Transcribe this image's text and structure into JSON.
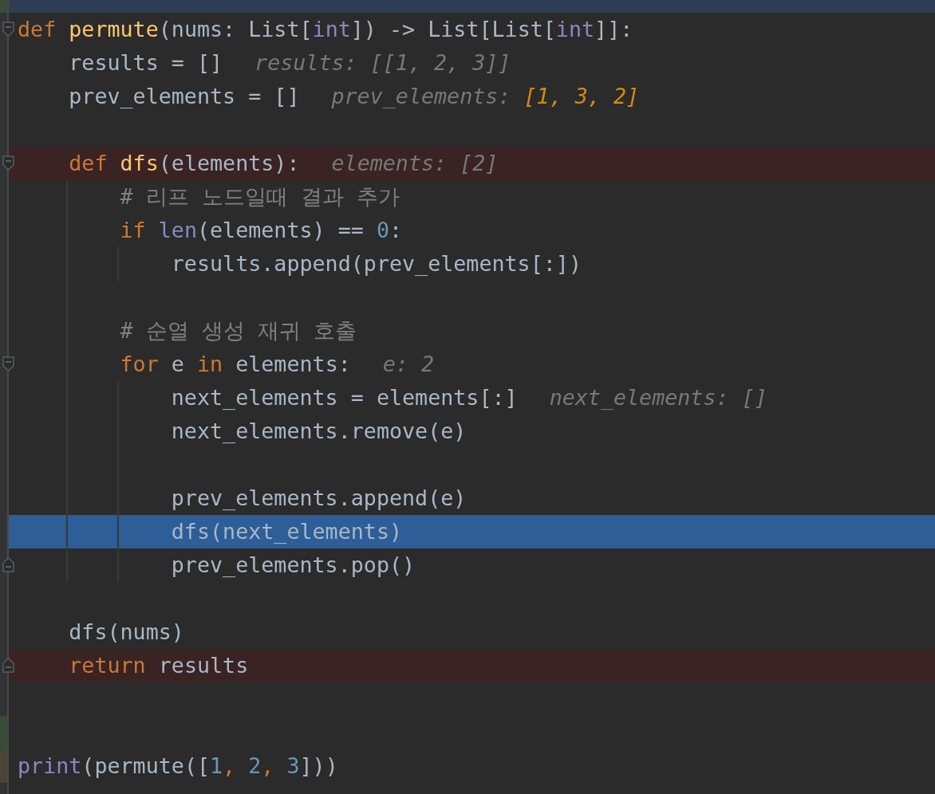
{
  "editor": {
    "partial_top_line": {
      "selected": true,
      "color": "#384c38"
    },
    "lines": [
      {
        "fold_start": true,
        "fold_end": false,
        "breakpoint": false,
        "current": false,
        "tokens": [
          {
            "text": "def ",
            "kind": "keyword"
          },
          {
            "text": "permute",
            "kind": "function"
          },
          {
            "text": "(nums: List[",
            "kind": "plain"
          },
          {
            "text": "int",
            "kind": "builtin"
          },
          {
            "text": "]) -> List[List[",
            "kind": "plain"
          },
          {
            "text": "int",
            "kind": "builtin"
          },
          {
            "text": "]]:",
            "kind": "plain"
          }
        ]
      },
      {
        "fold_start": false,
        "fold_end": false,
        "breakpoint": false,
        "current": false,
        "tokens": [
          {
            "text": "    results = []",
            "kind": "plain"
          }
        ],
        "inline_value": {
          "name": "results: ",
          "value": "[[1, 2, 3]]",
          "changed": false
        }
      },
      {
        "fold_start": false,
        "fold_end": false,
        "breakpoint": false,
        "current": false,
        "tokens": [
          {
            "text": "    prev_elements = []",
            "kind": "plain"
          }
        ],
        "inline_value": {
          "name": "prev_elements: ",
          "value": "[1, 3, 2]",
          "changed": true
        }
      },
      {
        "fold_start": false,
        "fold_end": false,
        "breakpoint": false,
        "current": false
      },
      {
        "fold_start": true,
        "fold_end": false,
        "breakpoint": true,
        "current": false,
        "tokens": [
          {
            "text": "    def ",
            "kind": "keyword"
          },
          {
            "text": "dfs",
            "kind": "function"
          },
          {
            "text": "(elements):",
            "kind": "plain"
          }
        ],
        "inline_value": {
          "name": "elements: ",
          "value": "[2]",
          "changed": false
        }
      },
      {
        "fold_start": false,
        "fold_end": false,
        "breakpoint": false,
        "current": false,
        "tokens": [
          {
            "text": "        # 리프 노드일때 결과 추가",
            "kind": "comment"
          }
        ]
      },
      {
        "fold_start": false,
        "fold_end": false,
        "breakpoint": false,
        "current": false,
        "tokens": [
          {
            "text": "        if ",
            "kind": "keyword"
          },
          {
            "text": "len",
            "kind": "builtin"
          },
          {
            "text": "(elements) == ",
            "kind": "plain"
          },
          {
            "text": "0",
            "kind": "number"
          },
          {
            "text": ":",
            "kind": "plain"
          }
        ]
      },
      {
        "fold_start": false,
        "fold_end": false,
        "breakpoint": false,
        "current": false,
        "tokens": [
          {
            "text": "            results.append(prev_elements[:])",
            "kind": "plain"
          }
        ]
      },
      {
        "fold_start": false,
        "fold_end": false,
        "breakpoint": false,
        "current": false
      },
      {
        "fold_start": false,
        "fold_end": false,
        "breakpoint": false,
        "current": false,
        "tokens": [
          {
            "text": "        # 순열 생성 재귀 호출",
            "kind": "comment"
          }
        ]
      },
      {
        "fold_start": true,
        "fold_end": false,
        "breakpoint": false,
        "current": false,
        "tokens": [
          {
            "text": "        for ",
            "kind": "keyword"
          },
          {
            "text": "e ",
            "kind": "plain"
          },
          {
            "text": "in ",
            "kind": "keyword"
          },
          {
            "text": "elements:",
            "kind": "plain"
          }
        ],
        "inline_value": {
          "name": "e: ",
          "value": "2",
          "changed": false
        }
      },
      {
        "fold_start": false,
        "fold_end": false,
        "breakpoint": false,
        "current": false,
        "tokens": [
          {
            "text": "            next_elements = elements[:]",
            "kind": "plain"
          }
        ],
        "inline_value": {
          "name": "next_elements: ",
          "value": "[]",
          "changed": false
        }
      },
      {
        "fold_start": false,
        "fold_end": false,
        "breakpoint": false,
        "current": false,
        "tokens": [
          {
            "text": "            next_elements.remove(e)",
            "kind": "plain"
          }
        ]
      },
      {
        "fold_start": false,
        "fold_end": false,
        "breakpoint": false,
        "current": false
      },
      {
        "fold_start": false,
        "fold_end": false,
        "breakpoint": false,
        "current": false,
        "tokens": [
          {
            "text": "            prev_elements.append(e)",
            "kind": "plain"
          }
        ]
      },
      {
        "fold_start": false,
        "fold_end": false,
        "breakpoint": false,
        "current": true,
        "tokens": [
          {
            "text": "            dfs(next_elements)",
            "kind": "plain"
          }
        ]
      },
      {
        "fold_start": false,
        "fold_end": true,
        "breakpoint": false,
        "current": false,
        "tokens": [
          {
            "text": "            prev_elements.pop()",
            "kind": "plain"
          }
        ]
      },
      {
        "fold_start": false,
        "fold_end": false,
        "breakpoint": false,
        "current": false
      },
      {
        "fold_start": false,
        "fold_end": false,
        "breakpoint": false,
        "current": false,
        "tokens": [
          {
            "text": "    dfs(nums)",
            "kind": "plain"
          }
        ]
      },
      {
        "fold_start": false,
        "fold_end": true,
        "breakpoint": true,
        "current": false,
        "tokens": [
          {
            "text": "    return ",
            "kind": "keyword"
          },
          {
            "text": "results",
            "kind": "plain"
          }
        ]
      },
      {
        "fold_start": false,
        "fold_end": false,
        "breakpoint": false,
        "current": false
      },
      {
        "fold_start": false,
        "fold_end": false,
        "breakpoint": false,
        "current": false,
        "color": "#384c38"
      },
      {
        "fold_start": false,
        "fold_end": false,
        "breakpoint": false,
        "current": false,
        "color": "#4b4536",
        "tokens": [
          {
            "text": "print",
            "kind": "builtin"
          },
          {
            "text": "(permute([",
            "kind": "plain"
          },
          {
            "text": "1",
            "kind": "number"
          },
          {
            "text": ", ",
            "kind": "keyword"
          },
          {
            "text": "2",
            "kind": "number"
          },
          {
            "text": ", ",
            "kind": "keyword"
          },
          {
            "text": "3",
            "kind": "number"
          },
          {
            "text": "]))",
            "kind": "plain"
          }
        ]
      }
    ]
  }
}
